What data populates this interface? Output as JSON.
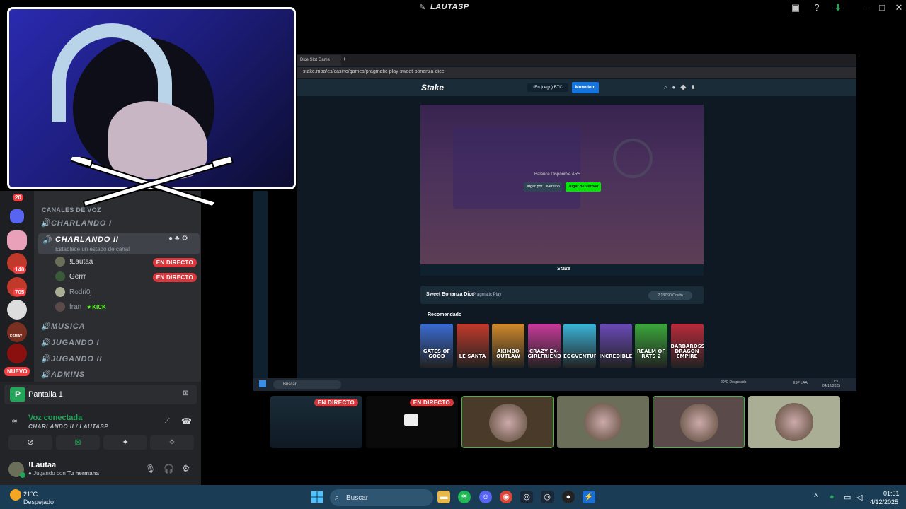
{
  "window": {
    "title": "LAUTASP"
  },
  "discord": {
    "server_badges": [
      "20",
      "140",
      "705"
    ],
    "server_labels": [
      "ESMAY"
    ],
    "new_badge": "NUEVO",
    "voice_header": "CANALES DE VOZ",
    "channels": [
      {
        "name": "CHARLANDO I"
      },
      {
        "name": "CHARLANDO II",
        "status": "Establece un estado de canal"
      },
      {
        "name": "MUSICA"
      },
      {
        "name": "JUGANDO I"
      },
      {
        "name": "JUGANDO II"
      },
      {
        "name": "ADMINS"
      }
    ],
    "members": [
      {
        "name": "!Lautaa",
        "live": "EN DIRECTO"
      },
      {
        "name": "Gerrr",
        "live": "EN DIRECTO"
      },
      {
        "name": "Rodri0j"
      },
      {
        "name": "fran",
        "tag": "KICK"
      }
    ],
    "stream_card": "Pantalla 1",
    "voice_connected": "Voz conectada",
    "voice_channel": "CHARLANDO II / LAUTASP",
    "user": {
      "name": "!Lautaa",
      "status_prefix": "Jugando con",
      "status_game": "Tu hermana"
    }
  },
  "browser": {
    "tab_title": "Dice Slot Game",
    "url": "stake.mba/es/casino/games/pragmatic-play-sweet-bonanza-dice",
    "stake": {
      "logo": "Stake",
      "balance": "(En juego) BTC",
      "wallet_button": "Monedero",
      "game_balance": "Balance Disponible ARS",
      "btn_demo": "Jugar por Diversión",
      "btn_real": "Jugar de Verdad",
      "game_name": "Sweet Bonanza Dice",
      "game_provider": "Pragmatic Play",
      "game_stat": "2,187.90 Oculto",
      "recommended_title": "Recomendado",
      "recommended": [
        {
          "title": "GATES OF GOOD",
          "color": "#3a6bd1"
        },
        {
          "title": "LE SANTA",
          "color": "#c23a2b"
        },
        {
          "title": "AKIMBO OUTLAW",
          "color": "#d18a2a"
        },
        {
          "title": "CRAZY EX-GIRLFRIEND",
          "color": "#c83a9a"
        },
        {
          "title": "EGGVENTURE",
          "color": "#3ab5d8"
        },
        {
          "title": "INCREDIBLE",
          "color": "#6a4ab8"
        },
        {
          "title": "REALM OF RATS 2",
          "color": "#3aa83a"
        },
        {
          "title": "BARBAROSSA: DRAGON EMPIRE",
          "color": "#b82a3a"
        }
      ]
    },
    "inner_taskbar": {
      "search": "Buscar",
      "weather": "20°C Despejado",
      "lang": "ESP LAA",
      "time": "1:51",
      "date": "04/12/2025"
    }
  },
  "tiles": [
    {
      "live": "EN DIRECTO",
      "kind": "screen"
    },
    {
      "live": "EN DIRECTO",
      "kind": "screen-dark"
    },
    {
      "kind": "avatar",
      "bg": "#4a3a2a",
      "border": "#4caf50"
    },
    {
      "kind": "avatar",
      "bg": "#6b6f5a"
    },
    {
      "kind": "avatar",
      "bg": "#5a4a4a",
      "border": "#4caf50"
    },
    {
      "kind": "avatar",
      "bg": "#a9ae94"
    }
  ],
  "taskbar": {
    "weather_temp": "21°C",
    "weather_desc": "Despejado",
    "search": "Buscar",
    "time": "01:51",
    "date": "4/12/2025"
  }
}
